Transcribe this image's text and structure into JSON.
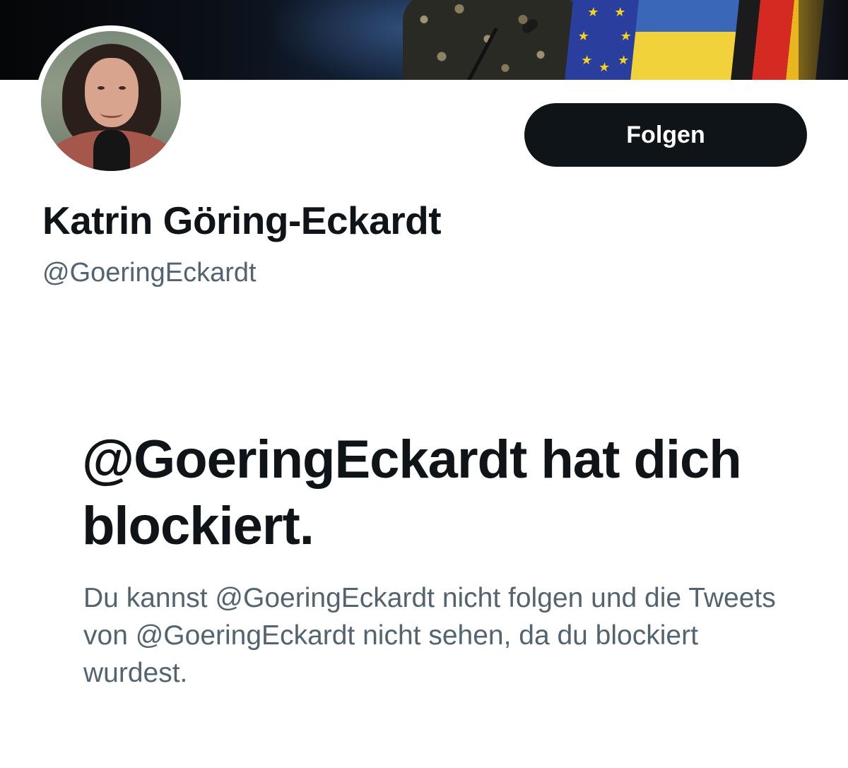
{
  "profile": {
    "display_name": "Katrin Göring-Eckardt",
    "handle": "@GoeringEckardt"
  },
  "actions": {
    "follow_label": "Folgen"
  },
  "blocked_notice": {
    "title": "@GoeringEckardt hat dich blockiert.",
    "message": "Du kannst @GoeringEckardt nicht folgen und die Tweets von @GoeringEckardt nicht sehen, da du blockiert wurdest."
  },
  "colors": {
    "primary_text": "#0f1419",
    "secondary_text": "#536471",
    "button_background": "#0f1419",
    "button_text": "#ffffff",
    "background": "#ffffff"
  }
}
